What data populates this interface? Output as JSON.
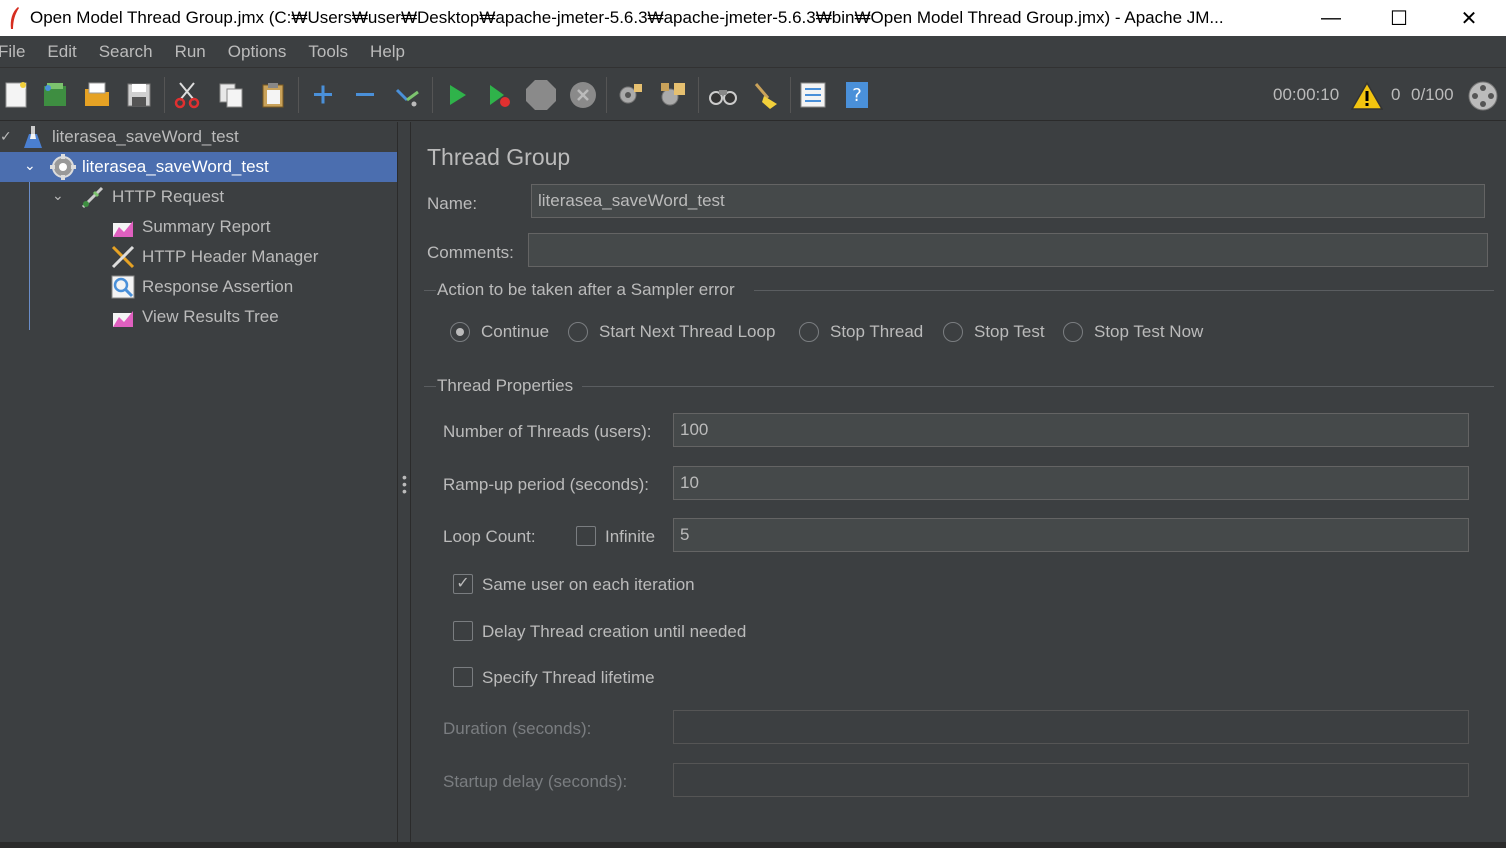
{
  "window": {
    "title": "Open Model Thread Group.jmx (C:₩Users₩user₩Desktop₩apache-jmeter-5.6.3₩apache-jmeter-5.6.3₩bin₩Open Model Thread Group.jmx) - Apache JM...",
    "minimize": "—",
    "maximize": "☐",
    "close": "✕"
  },
  "menu": [
    "File",
    "Edit",
    "Search",
    "Run",
    "Options",
    "Tools",
    "Help"
  ],
  "toolbar": {
    "icons": [
      "new-icon",
      "templates-icon",
      "open-icon",
      "save-icon",
      "cut-icon",
      "copy-icon",
      "paste-icon",
      "expand-icon",
      "collapse-icon",
      "toggle-icon",
      "start-icon",
      "start-no-pauses-icon",
      "stop-icon",
      "shutdown-icon",
      "clear-icon",
      "clear-all-icon",
      "search-icon",
      "reset-search-icon",
      "function-helper-icon",
      "help-icon"
    ],
    "timer": "00:00:10",
    "warning_count": "0",
    "threads": "0/100"
  },
  "tree": {
    "items": [
      {
        "label": "literasea_saveWord_test",
        "icon": "test-plan-icon"
      },
      {
        "label": "literasea_saveWord_test",
        "icon": "thread-group-icon"
      },
      {
        "label": "HTTP Request",
        "icon": "http-request-icon"
      },
      {
        "label": "Summary Report",
        "icon": "summary-report-icon"
      },
      {
        "label": "HTTP Header Manager",
        "icon": "header-manager-icon"
      },
      {
        "label": "Response Assertion",
        "icon": "assertion-icon"
      },
      {
        "label": "View Results Tree",
        "icon": "results-tree-icon"
      }
    ]
  },
  "panel": {
    "title": "Thread Group",
    "name_label": "Name:",
    "name_value": "literasea_saveWord_test",
    "comments_label": "Comments:",
    "comments_value": "",
    "action_group_title": "Action to be taken after a Sampler error",
    "actions": [
      "Continue",
      "Start Next Thread Loop",
      "Stop Thread",
      "Stop Test",
      "Stop Test Now"
    ],
    "selected_action": "Continue",
    "thread_props_title": "Thread Properties",
    "threads_label": "Number of Threads (users):",
    "threads_value": "100",
    "rampup_label": "Ramp-up period (seconds):",
    "rampup_value": "10",
    "loop_label": "Loop Count:",
    "infinite_label": "Infinite",
    "loop_value": "5",
    "same_user_label": "Same user on each iteration",
    "delay_label": "Delay Thread creation until needed",
    "lifetime_label": "Specify Thread lifetime",
    "duration_label": "Duration (seconds):",
    "duration_value": "",
    "startup_label": "Startup delay (seconds):",
    "startup_value": ""
  },
  "colors": {
    "background": "#3c3f41",
    "selection": "#4b6eaf",
    "text": "#bbbbbb"
  }
}
